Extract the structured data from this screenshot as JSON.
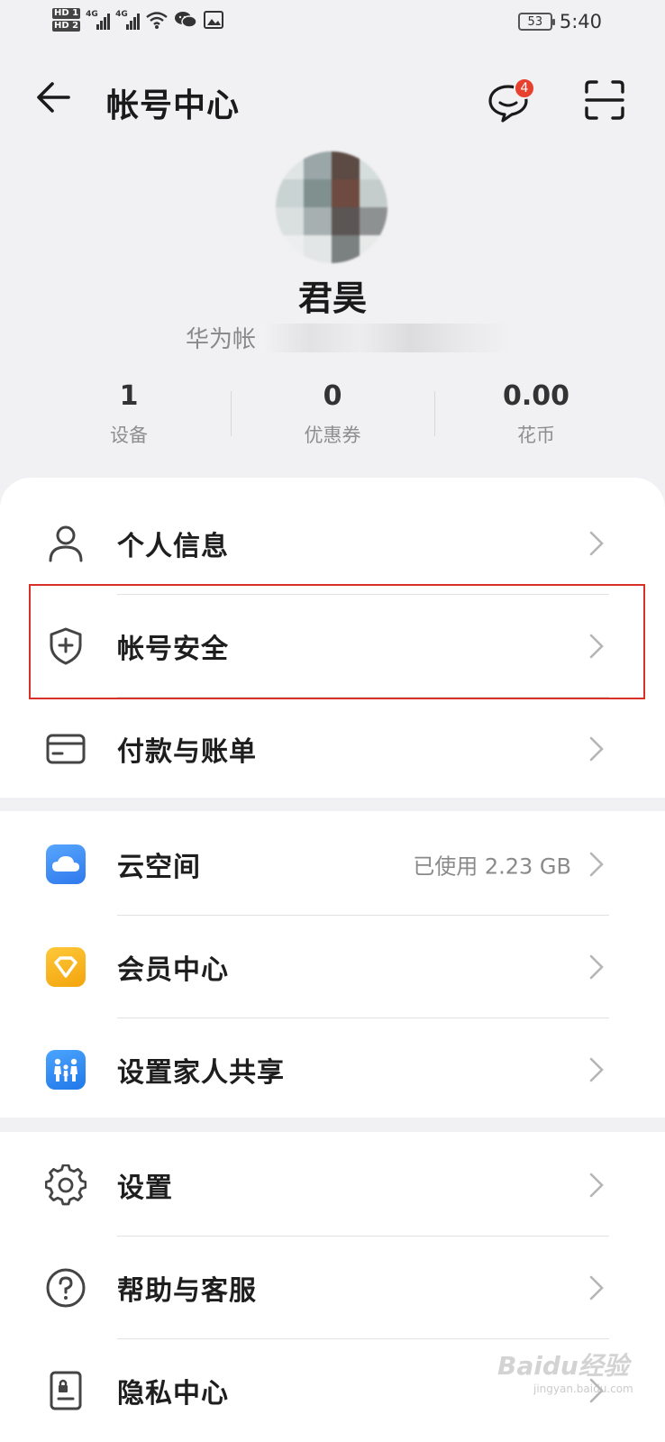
{
  "status_bar": {
    "hd1": "HD 1",
    "hd2": "HD 2",
    "net1": "4G",
    "net2": "4G",
    "battery": "53",
    "time": "5:40"
  },
  "header": {
    "title": "帐号中心",
    "message_badge": "4"
  },
  "profile": {
    "name": "君昊",
    "account_prefix": "华为帐"
  },
  "stats": [
    {
      "value": "1",
      "label": "设备"
    },
    {
      "value": "0",
      "label": "优惠券"
    },
    {
      "value": "0.00",
      "label": "花币"
    }
  ],
  "groups": {
    "account": [
      {
        "label": "个人信息",
        "icon": "person-icon"
      },
      {
        "label": "帐号安全",
        "icon": "shield-icon"
      },
      {
        "label": "付款与账单",
        "icon": "card-icon"
      }
    ],
    "services": [
      {
        "label": "云空间",
        "value": "已使用 2.23 GB",
        "icon": "cloud-icon"
      },
      {
        "label": "会员中心",
        "icon": "diamond-icon"
      },
      {
        "label": "设置家人共享",
        "icon": "family-icon"
      }
    ],
    "other": [
      {
        "label": "设置",
        "icon": "gear-icon"
      },
      {
        "label": "帮助与客服",
        "icon": "help-icon"
      },
      {
        "label": "隐私中心",
        "icon": "privacy-icon"
      }
    ]
  },
  "watermark": {
    "text": "Baidu经验",
    "url": "jingyan.baidu.com"
  },
  "colors": {
    "background": "#f1f1f3",
    "highlight": "#d9302a",
    "badge": "#e8402f",
    "cloud": "#3d8ff5",
    "member": "#f6b314",
    "family": "#2f8cf0"
  }
}
